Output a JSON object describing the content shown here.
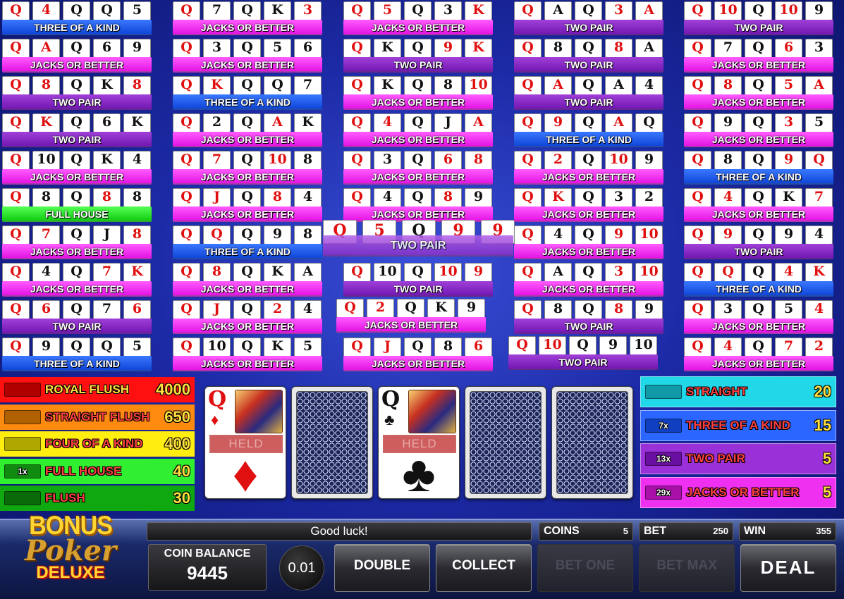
{
  "grid": {
    "columns": [
      [
        {
          "cards": [
            "Q",
            "4",
            "Q",
            "Q",
            "5"
          ],
          "colors": [
            "r",
            "r",
            "b",
            "b",
            "b"
          ],
          "result": "THREE OF A KIND"
        },
        {
          "cards": [
            "Q",
            "A",
            "Q",
            "6",
            "9"
          ],
          "colors": [
            "r",
            "r",
            "b",
            "b",
            "b"
          ],
          "result": "JACKS OR BETTER"
        },
        {
          "cards": [
            "Q",
            "8",
            "Q",
            "K",
            "8"
          ],
          "colors": [
            "r",
            "r",
            "b",
            "b",
            "r"
          ],
          "result": "TWO PAIR"
        },
        {
          "cards": [
            "Q",
            "K",
            "Q",
            "6",
            "K"
          ],
          "colors": [
            "r",
            "r",
            "b",
            "b",
            "b"
          ],
          "result": "TWO PAIR"
        },
        {
          "cards": [
            "Q",
            "10",
            "Q",
            "K",
            "4"
          ],
          "colors": [
            "r",
            "b",
            "b",
            "b",
            "b"
          ],
          "result": "JACKS OR BETTER"
        },
        {
          "cards": [
            "Q",
            "8",
            "Q",
            "8",
            "8"
          ],
          "colors": [
            "r",
            "b",
            "b",
            "r",
            "b"
          ],
          "result": "FULL HOUSE"
        },
        {
          "cards": [
            "Q",
            "7",
            "Q",
            "J",
            "8"
          ],
          "colors": [
            "r",
            "r",
            "b",
            "b",
            "r"
          ],
          "result": "JACKS OR BETTER"
        },
        {
          "cards": [
            "Q",
            "4",
            "Q",
            "7",
            "K"
          ],
          "colors": [
            "r",
            "b",
            "b",
            "r",
            "r"
          ],
          "result": "JACKS OR BETTER"
        },
        {
          "cards": [
            "Q",
            "6",
            "Q",
            "7",
            "6"
          ],
          "colors": [
            "r",
            "r",
            "b",
            "b",
            "r"
          ],
          "result": "TWO PAIR"
        },
        {
          "cards": [
            "Q",
            "9",
            "Q",
            "Q",
            "5"
          ],
          "colors": [
            "r",
            "b",
            "b",
            "b",
            "b"
          ],
          "result": "THREE OF A KIND"
        }
      ],
      [
        {
          "cards": [
            "Q",
            "7",
            "Q",
            "K",
            "3"
          ],
          "colors": [
            "r",
            "b",
            "b",
            "b",
            "r"
          ],
          "result": "JACKS OR BETTER"
        },
        {
          "cards": [
            "Q",
            "3",
            "Q",
            "5",
            "6"
          ],
          "colors": [
            "r",
            "b",
            "b",
            "b",
            "b"
          ],
          "result": "JACKS OR BETTER"
        },
        {
          "cards": [
            "Q",
            "K",
            "Q",
            "Q",
            "7"
          ],
          "colors": [
            "r",
            "r",
            "b",
            "b",
            "b"
          ],
          "result": "THREE OF A KIND"
        },
        {
          "cards": [
            "Q",
            "2",
            "Q",
            "A",
            "K"
          ],
          "colors": [
            "r",
            "b",
            "b",
            "r",
            "b"
          ],
          "result": "JACKS OR BETTER"
        },
        {
          "cards": [
            "Q",
            "7",
            "Q",
            "10",
            "8"
          ],
          "colors": [
            "r",
            "r",
            "b",
            "r",
            "b"
          ],
          "result": "JACKS OR BETTER"
        },
        {
          "cards": [
            "Q",
            "J",
            "Q",
            "8",
            "4"
          ],
          "colors": [
            "r",
            "r",
            "b",
            "r",
            "b"
          ],
          "result": "JACKS OR BETTER"
        },
        {
          "cards": [
            "Q",
            "Q",
            "Q",
            "9",
            "8"
          ],
          "colors": [
            "r",
            "r",
            "b",
            "b",
            "b"
          ],
          "result": "THREE OF A KIND"
        },
        {
          "cards": [
            "Q",
            "8",
            "Q",
            "K",
            "A"
          ],
          "colors": [
            "r",
            "r",
            "b",
            "b",
            "b"
          ],
          "result": "JACKS OR BETTER"
        },
        {
          "cards": [
            "Q",
            "J",
            "Q",
            "2",
            "4"
          ],
          "colors": [
            "r",
            "r",
            "b",
            "r",
            "b"
          ],
          "result": "JACKS OR BETTER"
        },
        {
          "cards": [
            "Q",
            "10",
            "Q",
            "K",
            "5"
          ],
          "colors": [
            "r",
            "b",
            "b",
            "b",
            "b"
          ],
          "result": "JACKS OR BETTER"
        }
      ],
      [
        {
          "cards": [
            "Q",
            "5",
            "Q",
            "3",
            "K"
          ],
          "colors": [
            "r",
            "r",
            "b",
            "b",
            "r"
          ],
          "result": "JACKS OR BETTER"
        },
        {
          "cards": [
            "Q",
            "K",
            "Q",
            "9",
            "K"
          ],
          "colors": [
            "r",
            "b",
            "b",
            "r",
            "r"
          ],
          "result": "TWO PAIR"
        },
        {
          "cards": [
            "Q",
            "K",
            "Q",
            "8",
            "10"
          ],
          "colors": [
            "r",
            "b",
            "b",
            "b",
            "r"
          ],
          "result": "JACKS OR BETTER"
        },
        {
          "cards": [
            "Q",
            "4",
            "Q",
            "J",
            "A"
          ],
          "colors": [
            "r",
            "r",
            "b",
            "b",
            "r"
          ],
          "result": "JACKS OR BETTER"
        },
        {
          "cards": [
            "Q",
            "3",
            "Q",
            "6",
            "8"
          ],
          "colors": [
            "r",
            "b",
            "b",
            "r",
            "r"
          ],
          "result": "JACKS OR BETTER"
        },
        {
          "cards": [
            "Q",
            "4",
            "Q",
            "8",
            "9"
          ],
          "colors": [
            "r",
            "b",
            "b",
            "r",
            "b"
          ],
          "result": "JACKS OR BETTER"
        },
        {
          "cards": [
            "Q",
            "5",
            "Q",
            "9",
            "9"
          ],
          "colors": [
            "r",
            "r",
            "b",
            "r",
            "r"
          ],
          "result": "TWO PAIR"
        },
        {
          "cards": [
            "Q",
            "10",
            "Q",
            "10",
            "9"
          ],
          "colors": [
            "r",
            "b",
            "b",
            "r",
            "r"
          ],
          "result": "TWO PAIR"
        },
        {
          "cards": [
            "Q",
            "2",
            "Q",
            "K",
            "9"
          ],
          "colors": [
            "r",
            "r",
            "b",
            "b",
            "b"
          ],
          "result": "JACKS OR BETTER"
        },
        {
          "cards": [
            "Q",
            "J",
            "Q",
            "8",
            "6"
          ],
          "colors": [
            "r",
            "r",
            "b",
            "b",
            "r"
          ],
          "result": "JACKS OR BETTER"
        }
      ],
      [
        {
          "cards": [
            "Q",
            "A",
            "Q",
            "3",
            "A"
          ],
          "colors": [
            "r",
            "b",
            "b",
            "r",
            "r"
          ],
          "result": "TWO PAIR"
        },
        {
          "cards": [
            "Q",
            "8",
            "Q",
            "8",
            "A"
          ],
          "colors": [
            "r",
            "b",
            "b",
            "r",
            "b"
          ],
          "result": "TWO PAIR"
        },
        {
          "cards": [
            "Q",
            "A",
            "Q",
            "A",
            "4"
          ],
          "colors": [
            "r",
            "r",
            "b",
            "b",
            "b"
          ],
          "result": "TWO PAIR"
        },
        {
          "cards": [
            "Q",
            "9",
            "Q",
            "A",
            "Q"
          ],
          "colors": [
            "r",
            "r",
            "b",
            "r",
            "b"
          ],
          "result": "THREE OF A KIND"
        },
        {
          "cards": [
            "Q",
            "2",
            "Q",
            "10",
            "9"
          ],
          "colors": [
            "r",
            "r",
            "b",
            "r",
            "b"
          ],
          "result": "JACKS OR BETTER"
        },
        {
          "cards": [
            "Q",
            "K",
            "Q",
            "3",
            "2"
          ],
          "colors": [
            "r",
            "r",
            "b",
            "b",
            "b"
          ],
          "result": "JACKS OR BETTER"
        },
        {
          "cards": [
            "Q",
            "4",
            "Q",
            "9",
            "10"
          ],
          "colors": [
            "r",
            "b",
            "b",
            "r",
            "r"
          ],
          "result": "JACKS OR BETTER"
        },
        {
          "cards": [
            "Q",
            "A",
            "Q",
            "3",
            "10"
          ],
          "colors": [
            "r",
            "b",
            "b",
            "r",
            "r"
          ],
          "result": "JACKS OR BETTER"
        },
        {
          "cards": [
            "Q",
            "8",
            "Q",
            "8",
            "9"
          ],
          "colors": [
            "r",
            "b",
            "b",
            "r",
            "b"
          ],
          "result": "TWO PAIR"
        },
        {
          "cards": [
            "Q",
            "10",
            "Q",
            "9",
            "10"
          ],
          "colors": [
            "r",
            "r",
            "b",
            "b",
            "b"
          ],
          "result": "TWO PAIR"
        }
      ],
      [
        {
          "cards": [
            "Q",
            "10",
            "Q",
            "10",
            "9"
          ],
          "colors": [
            "r",
            "r",
            "b",
            "r",
            "b"
          ],
          "result": "TWO PAIR"
        },
        {
          "cards": [
            "Q",
            "7",
            "Q",
            "6",
            "3"
          ],
          "colors": [
            "r",
            "b",
            "b",
            "r",
            "b"
          ],
          "result": "JACKS OR BETTER"
        },
        {
          "cards": [
            "Q",
            "8",
            "Q",
            "5",
            "A"
          ],
          "colors": [
            "r",
            "r",
            "b",
            "r",
            "r"
          ],
          "result": "JACKS OR BETTER"
        },
        {
          "cards": [
            "Q",
            "9",
            "Q",
            "3",
            "5"
          ],
          "colors": [
            "r",
            "b",
            "b",
            "r",
            "b"
          ],
          "result": "JACKS OR BETTER"
        },
        {
          "cards": [
            "Q",
            "8",
            "Q",
            "9",
            "Q"
          ],
          "colors": [
            "r",
            "b",
            "b",
            "r",
            "r"
          ],
          "result": "THREE OF A KIND"
        },
        {
          "cards": [
            "Q",
            "4",
            "Q",
            "K",
            "7"
          ],
          "colors": [
            "r",
            "r",
            "b",
            "b",
            "r"
          ],
          "result": "JACKS OR BETTER"
        },
        {
          "cards": [
            "Q",
            "9",
            "Q",
            "9",
            "4"
          ],
          "colors": [
            "r",
            "r",
            "b",
            "b",
            "b"
          ],
          "result": "TWO PAIR"
        },
        {
          "cards": [
            "Q",
            "Q",
            "Q",
            "4",
            "K"
          ],
          "colors": [
            "r",
            "r",
            "b",
            "r",
            "r"
          ],
          "result": "THREE OF A KIND"
        },
        {
          "cards": [
            "Q",
            "3",
            "Q",
            "5",
            "4"
          ],
          "colors": [
            "r",
            "b",
            "b",
            "b",
            "r"
          ],
          "result": "JACKS OR BETTER"
        },
        {
          "cards": [
            "Q",
            "4",
            "Q",
            "7",
            "2"
          ],
          "colors": [
            "r",
            "r",
            "b",
            "r",
            "r"
          ],
          "result": "JACKS OR BETTER"
        }
      ]
    ]
  },
  "paytable": {
    "left": [
      {
        "name": "ROYAL FLUSH",
        "value": "4000",
        "mult": "",
        "color": "#ff1010",
        "box": "#b00000"
      },
      {
        "name": "STRAIGHT FLUSH",
        "value": "650",
        "mult": "",
        "color": "#ff8a10",
        "box": "#b06000"
      },
      {
        "name": "FOUR OF A KIND",
        "value": "400",
        "mult": "",
        "color": "#ffee10",
        "box": "#b0a800"
      },
      {
        "name": "FULL HOUSE",
        "value": "40",
        "mult": "1x",
        "color": "#30ee30",
        "box": "#108a10"
      },
      {
        "name": "FLUSH",
        "value": "30",
        "mult": "",
        "color": "#10a810",
        "box": "#0a6a0a"
      }
    ],
    "right": [
      {
        "name": "STRAIGHT",
        "value": "20",
        "mult": "",
        "color": "#20d8e8",
        "box": "#109aa8"
      },
      {
        "name": "THREE OF A KIND",
        "value": "15",
        "mult": "7x",
        "color": "#2a66ff",
        "box": "#1040c0"
      },
      {
        "name": "TWO PAIR",
        "value": "5",
        "mult": "13x",
        "color": "#9a30d8",
        "box": "#6a10a0"
      },
      {
        "name": "JACKS OR BETTER",
        "value": "5",
        "mult": "29x",
        "color": "#f030f0",
        "box": "#a810a8"
      }
    ]
  },
  "main_hand": {
    "cards": [
      {
        "type": "face",
        "rank": "Q",
        "suit": "♦",
        "color": "#e01010",
        "held": "HELD"
      },
      {
        "type": "back"
      },
      {
        "type": "face",
        "rank": "Q",
        "suit": "♣",
        "color": "#111111",
        "held": "HELD"
      },
      {
        "type": "back"
      },
      {
        "type": "back"
      }
    ]
  },
  "logo": {
    "line1": "BONUS",
    "line2": "Poker",
    "line3": "DELUXE"
  },
  "status": {
    "message": "Good luck!"
  },
  "stats": {
    "coins_label": "COINS",
    "coins": "5",
    "bet_label": "BET",
    "bet": "250",
    "win_label": "WIN",
    "win": "355"
  },
  "balance": {
    "label": "COIN BALANCE",
    "value": "9445"
  },
  "denomination": "0.01",
  "buttons": {
    "double": "DOUBLE",
    "collect": "COLLECT",
    "bet_one": "BET ONE",
    "bet_max": "BET MAX",
    "deal": "DEAL"
  },
  "colors": {
    "result_jacks": "#f030f0",
    "result_two_pair": "#8a24c8",
    "result_three": "#2a66ff",
    "result_full_house": "#30ee30"
  }
}
